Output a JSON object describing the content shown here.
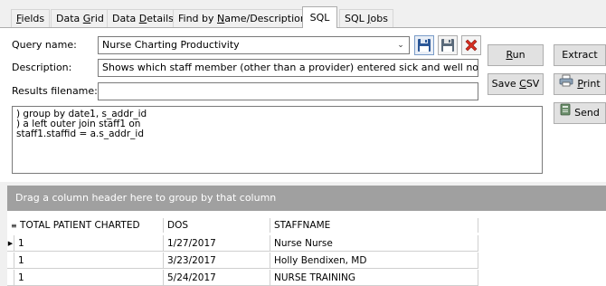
{
  "tabs": [
    {
      "label": "Fields",
      "mnemonic": "F",
      "rest": "ields"
    },
    {
      "label": "Data Grid",
      "pre": "Data ",
      "mnemonic": "G",
      "rest": "rid"
    },
    {
      "label": "Data Details",
      "pre": "Data ",
      "mnemonic": "D",
      "rest": "etails"
    },
    {
      "label": "Find by Name/Description",
      "pre": "Find by ",
      "mnemonic": "N",
      "rest": "ame/Description"
    },
    {
      "label": "SQL",
      "mnemonic": "",
      "rest": "SQL",
      "active": true
    },
    {
      "label": "SQL Jobs",
      "pre": "SQL ",
      "mnemonic": "J",
      "rest": "obs"
    }
  ],
  "form": {
    "query_label": "Query name:",
    "query_value": "Nurse Charting Productivity",
    "description_label": "Description:",
    "description_value": "Shows which staff member (other than a provider) entered sick and well notes for",
    "results_label": "Results filename:",
    "results_value": ""
  },
  "buttons": {
    "run_mnemonic": "R",
    "run_rest": "un",
    "extract_label": "Extract",
    "save_csv_pre": "Save ",
    "save_csv_mnemonic": "C",
    "save_csv_rest": "SV",
    "print_mnemonic": "P",
    "print_rest": "rint",
    "send_label": "Send"
  },
  "icons": {
    "save": "floppy-disk-icon",
    "save_as": "floppy-disk-gray-icon",
    "delete": "red-x-icon",
    "print": "printer-icon",
    "send": "send-icon"
  },
  "sql_lines": [
    ") group by date1, s_addr_id",
    ") a left outer join staff1 on",
    "staff1.staffid = a.s_addr_id"
  ],
  "grid": {
    "group_hint": "Drag a column header here to group by that column",
    "columns": [
      "TOTAL PATIENT CHARTED",
      "DOS",
      "STAFFNAME"
    ],
    "rows": [
      [
        "1",
        "1/27/2017",
        "Nurse Nurse"
      ],
      [
        "1",
        "3/23/2017",
        "Holly Bendixen, MD"
      ],
      [
        "1",
        "5/24/2017",
        "NURSE TRAINING"
      ]
    ]
  },
  "colors": {
    "group_panel": "#a0a0a0",
    "delete_red": "#d62d20",
    "save_blue": "#2b5797"
  }
}
